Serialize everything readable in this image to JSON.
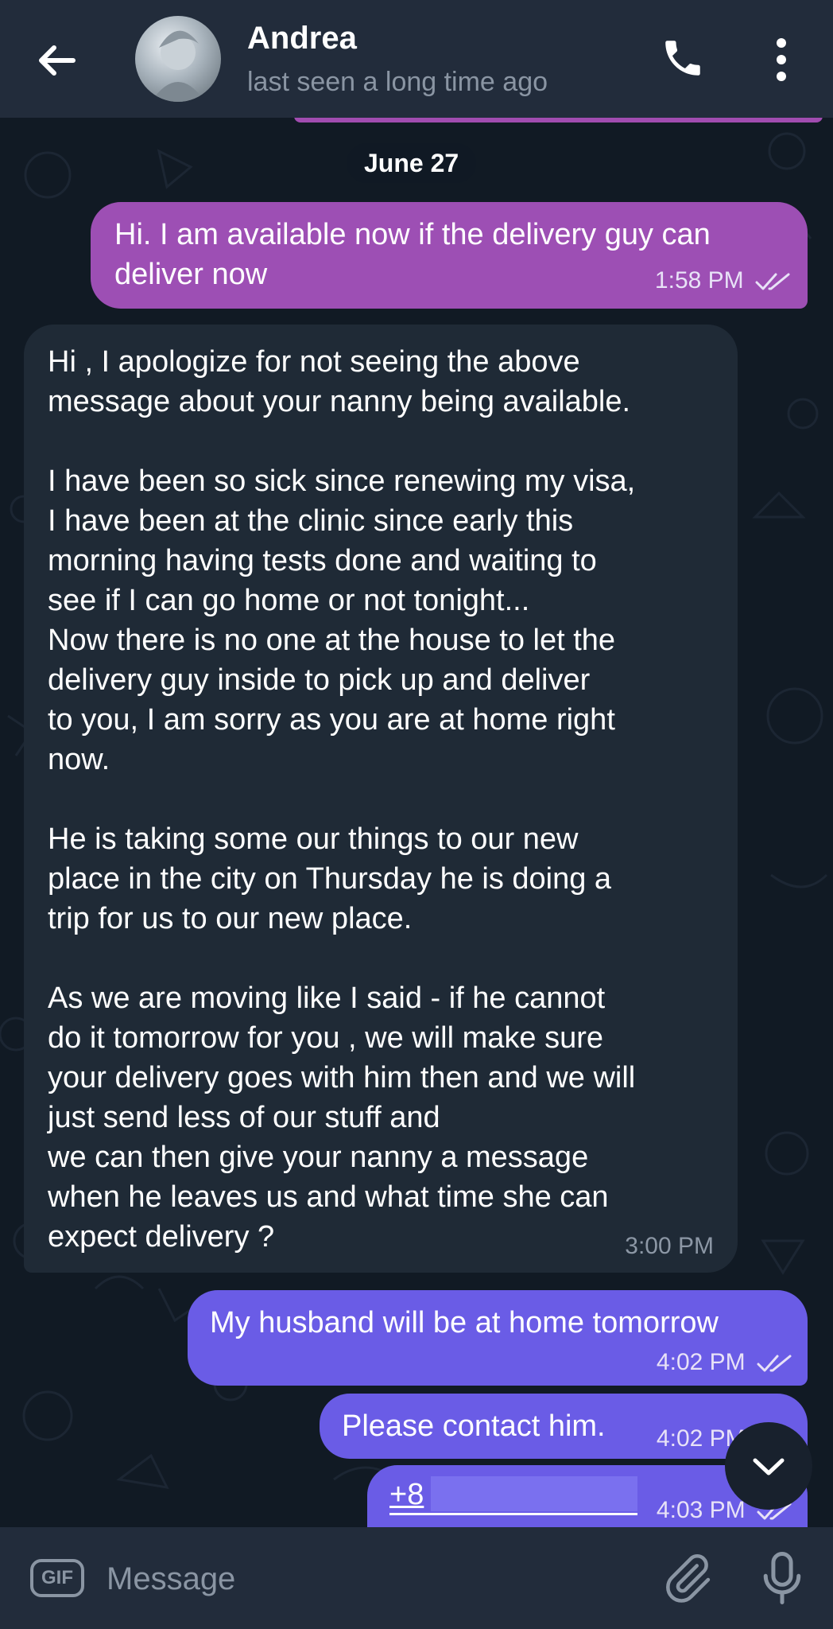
{
  "header": {
    "contact_name": "Andrea",
    "status": "last seen a long time ago",
    "back_icon": "arrow-left-icon",
    "call_icon": "phone-icon",
    "more_icon": "more-vertical-icon"
  },
  "chat": {
    "date_label": "June 27",
    "messages": [
      {
        "direction": "outgoing",
        "text": "Hi. I am available now if the delivery guy can\ndeliver now",
        "time": "1:58 PM",
        "status": "read"
      },
      {
        "direction": "incoming",
        "text": "Hi , I apologize for not seeing the above\nmessage about your nanny being available.\n\nI have been so sick since renewing my visa,\nI have been at the clinic since early this\nmorning having tests done and waiting to\nsee if I can go home or not tonight...\nNow there is no one at the house to let the\ndelivery guy inside to pick up and deliver\nto you, I am sorry as you are at home right\nnow.\n\nHe is taking some our things to our new\nplace in the city on Thursday he is doing a\ntrip for us to our new place.\n\nAs we are moving like I said - if he cannot\ndo it tomorrow for you , we will make sure\nyour delivery goes with him then and we will\njust send less of our stuff and\nwe can then give your nanny a message\nwhen he leaves us and what time she can\nexpect delivery ?",
        "time": "3:00 PM"
      },
      {
        "direction": "outgoing",
        "text": "My husband will be at home tomorrow",
        "time": "4:02 PM",
        "status": "read"
      },
      {
        "direction": "outgoing",
        "text": "Please contact him.",
        "time": "4:02 PM",
        "status": "read"
      },
      {
        "direction": "outgoing",
        "text": "+8",
        "time": "4:03 PM",
        "status": "read"
      }
    ]
  },
  "composer": {
    "gif_label": "GIF",
    "placeholder": "Message",
    "attach_icon": "paperclip-icon",
    "mic_icon": "microphone-icon"
  },
  "scroll_down_icon": "chevron-down-icon",
  "colors": {
    "background": "#111a24",
    "header": "#222c3b",
    "outgoing_purple": "#9d4fb4",
    "outgoing_violet": "#6a5ce6",
    "incoming": "#1f2a36"
  }
}
